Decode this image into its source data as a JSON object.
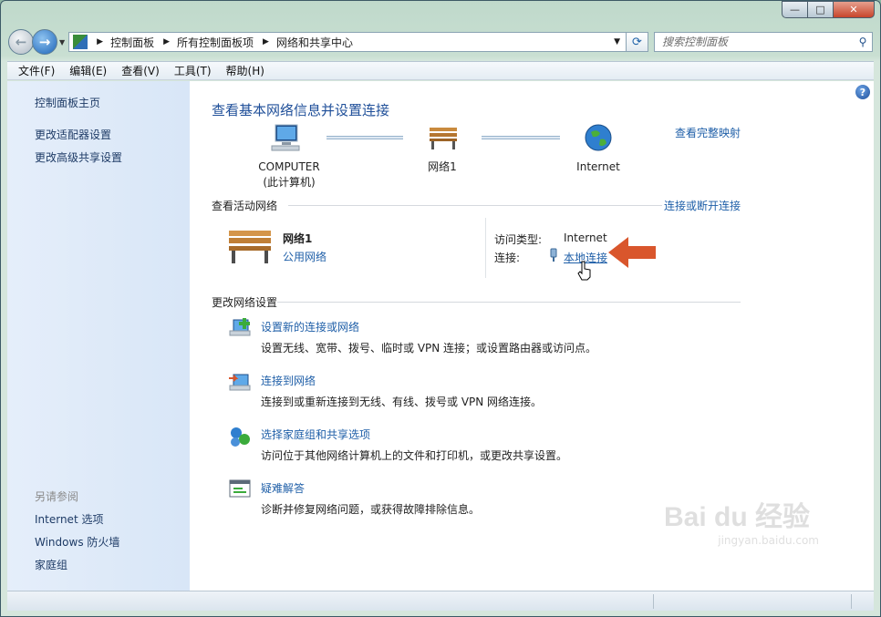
{
  "window": {
    "min": "—",
    "max": "□",
    "close": "✕"
  },
  "nav": {
    "back": "←",
    "forward": "→"
  },
  "address": {
    "crumbs": [
      "控制面板",
      "所有控制面板项",
      "网络和共享中心"
    ]
  },
  "search": {
    "placeholder": "搜索控制面板"
  },
  "menu": [
    "文件(F)",
    "编辑(E)",
    "查看(V)",
    "工具(T)",
    "帮助(H)"
  ],
  "sidebar": {
    "links": [
      "控制面板主页",
      "更改适配器设置",
      "更改高级共享设置"
    ],
    "see_also_title": "另请参阅",
    "see_also": [
      "Internet 选项",
      "Windows 防火墙",
      "家庭组"
    ]
  },
  "main": {
    "help": "?",
    "title": "查看基本网络信息并设置连接",
    "full_map": "查看完整映射",
    "nodes": [
      {
        "label": "COMPUTER",
        "sub": "(此计算机)"
      },
      {
        "label": "网络1",
        "sub": ""
      },
      {
        "label": "Internet",
        "sub": ""
      }
    ],
    "active_section": "查看活动网络",
    "connect_toggle": "连接或断开连接",
    "network": {
      "name": "网络1",
      "type": "公用网络",
      "access_label": "访问类型:",
      "access_value": "Internet",
      "conn_label": "连接:",
      "conn_value": "本地连接"
    },
    "change_section": "更改网络设置",
    "tasks": [
      {
        "title": "设置新的连接或网络",
        "desc": "设置无线、宽带、拨号、临时或 VPN 连接；或设置路由器或访问点。"
      },
      {
        "title": "连接到网络",
        "desc": "连接到或重新连接到无线、有线、拨号或 VPN 网络连接。"
      },
      {
        "title": "选择家庭组和共享选项",
        "desc": "访问位于其他网络计算机上的文件和打印机，或更改共享设置。"
      },
      {
        "title": "疑难解答",
        "desc": "诊断并修复网络问题，或获得故障排除信息。"
      }
    ]
  },
  "watermark": {
    "brand": "Bai du 经验",
    "url": "jingyan.baidu.com"
  },
  "colors": {
    "link": "#1f5fa8",
    "title": "#1f4f99",
    "arrow": "#d9562c",
    "sidebar": "#dce8f7"
  }
}
